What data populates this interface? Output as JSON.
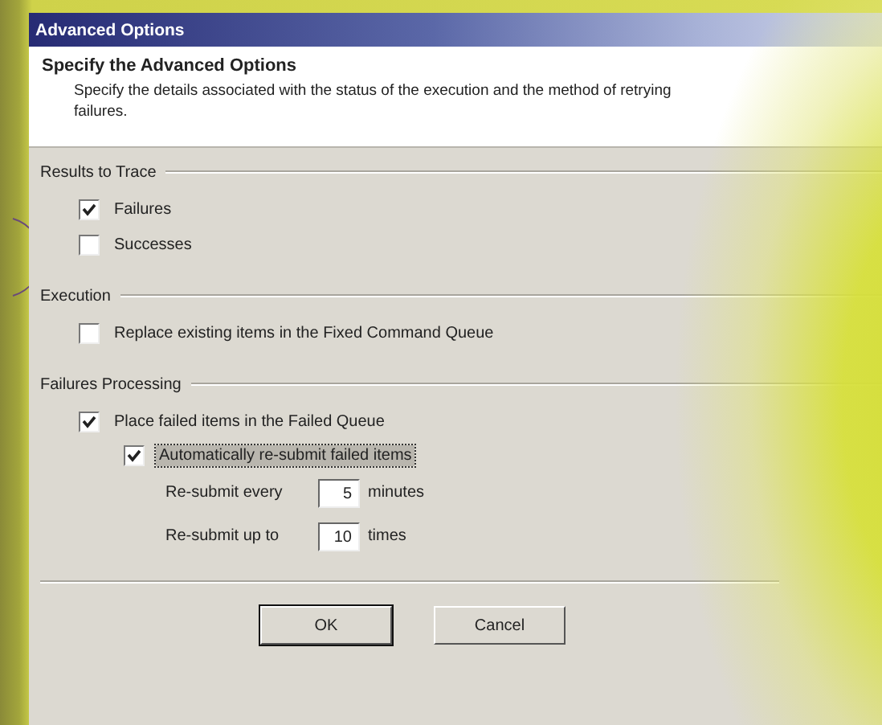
{
  "window": {
    "title": "Advanced Options"
  },
  "header": {
    "title": "Specify the Advanced Options",
    "description": "Specify the details associated with the status of the execution and the method of retrying failures."
  },
  "groups": [
    {
      "title": "Results to Trace",
      "items": [
        {
          "kind": "checkbox",
          "label": "Failures",
          "checked": true
        },
        {
          "kind": "checkbox",
          "label": "Successes",
          "checked": false
        }
      ]
    },
    {
      "title": "Execution",
      "items": [
        {
          "kind": "checkbox",
          "label": "Replace existing items in the Fixed Command Queue",
          "checked": false
        }
      ]
    },
    {
      "title": "Failures Processing",
      "items": [
        {
          "kind": "checkbox",
          "label": "Place failed items in the Failed Queue",
          "checked": true
        },
        {
          "kind": "checkbox",
          "label": "Automatically re-submit failed items",
          "checked": true,
          "focused": true,
          "indent": true
        },
        {
          "kind": "number",
          "label": "Re-submit every",
          "value": "5",
          "unit": "minutes"
        },
        {
          "kind": "number",
          "label": "Re-submit up to",
          "value": "10",
          "unit": "times"
        }
      ]
    }
  ],
  "buttons": [
    {
      "label": "OK",
      "default": true
    },
    {
      "label": "Cancel",
      "default": false
    }
  ]
}
